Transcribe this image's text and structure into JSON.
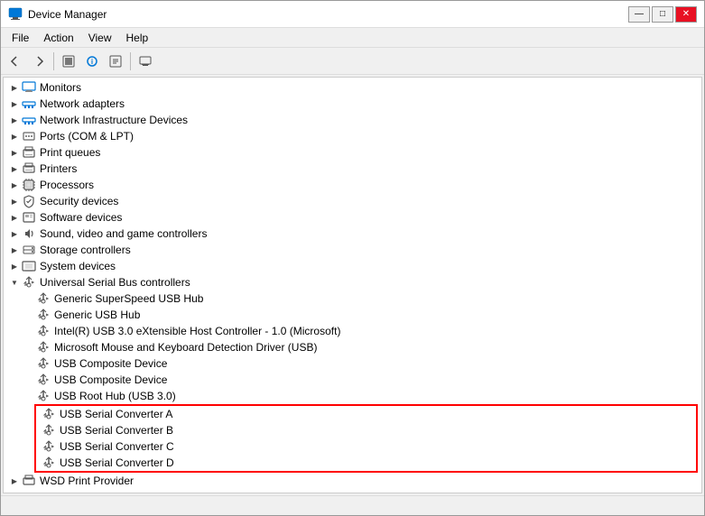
{
  "window": {
    "title": "Device Manager",
    "controls": {
      "minimize": "—",
      "maximize": "□",
      "close": "✕"
    }
  },
  "menu": {
    "items": [
      "File",
      "Action",
      "View",
      "Help"
    ]
  },
  "toolbar": {
    "buttons": [
      "←",
      "→",
      "⬜",
      "ℹ",
      "⬜",
      "🖥"
    ]
  },
  "tree": {
    "items": [
      {
        "id": "monitors",
        "label": "Monitors",
        "indent": 0,
        "chevron": "closed",
        "icon": "monitor"
      },
      {
        "id": "network-adapters",
        "label": "Network adapters",
        "indent": 0,
        "chevron": "closed",
        "icon": "network"
      },
      {
        "id": "network-infra",
        "label": "Network Infrastructure Devices",
        "indent": 0,
        "chevron": "closed",
        "icon": "network"
      },
      {
        "id": "ports",
        "label": "Ports (COM & LPT)",
        "indent": 0,
        "chevron": "closed",
        "icon": "generic"
      },
      {
        "id": "print-queues",
        "label": "Print queues",
        "indent": 0,
        "chevron": "closed",
        "icon": "printer"
      },
      {
        "id": "printers",
        "label": "Printers",
        "indent": 0,
        "chevron": "closed",
        "icon": "printer"
      },
      {
        "id": "processors",
        "label": "Processors",
        "indent": 0,
        "chevron": "closed",
        "icon": "chip"
      },
      {
        "id": "security",
        "label": "Security devices",
        "indent": 0,
        "chevron": "closed",
        "icon": "security"
      },
      {
        "id": "software",
        "label": "Software devices",
        "indent": 0,
        "chevron": "closed",
        "icon": "generic"
      },
      {
        "id": "sound",
        "label": "Sound, video and game controllers",
        "indent": 0,
        "chevron": "closed",
        "icon": "sound"
      },
      {
        "id": "storage",
        "label": "Storage controllers",
        "indent": 0,
        "chevron": "closed",
        "icon": "storage"
      },
      {
        "id": "system",
        "label": "System devices",
        "indent": 0,
        "chevron": "closed",
        "icon": "system"
      },
      {
        "id": "usb",
        "label": "Universal Serial Bus controllers",
        "indent": 0,
        "chevron": "open",
        "icon": "usb"
      },
      {
        "id": "superspeed-hub",
        "label": "Generic SuperSpeed USB Hub",
        "indent": 1,
        "chevron": "none",
        "icon": "usb-device"
      },
      {
        "id": "generic-hub",
        "label": "Generic USB Hub",
        "indent": 1,
        "chevron": "none",
        "icon": "usb-device"
      },
      {
        "id": "intel-usb",
        "label": "Intel(R) USB 3.0 eXtensible Host Controller - 1.0 (Microsoft)",
        "indent": 1,
        "chevron": "none",
        "icon": "usb-device"
      },
      {
        "id": "ms-mouse",
        "label": "Microsoft Mouse and Keyboard Detection Driver (USB)",
        "indent": 1,
        "chevron": "none",
        "icon": "usb-device"
      },
      {
        "id": "usb-composite-1",
        "label": "USB Composite Device",
        "indent": 1,
        "chevron": "none",
        "icon": "usb-device"
      },
      {
        "id": "usb-composite-2",
        "label": "USB Composite Device",
        "indent": 1,
        "chevron": "none",
        "icon": "usb-device"
      },
      {
        "id": "usb-root-hub",
        "label": "USB Root Hub (USB 3.0)",
        "indent": 1,
        "chevron": "none",
        "icon": "usb-device"
      },
      {
        "id": "usb-serial-a",
        "label": "USB Serial Converter A",
        "indent": 1,
        "chevron": "none",
        "icon": "usb-device",
        "highlighted": true
      },
      {
        "id": "usb-serial-b",
        "label": "USB Serial Converter B",
        "indent": 1,
        "chevron": "none",
        "icon": "usb-device",
        "highlighted": true
      },
      {
        "id": "usb-serial-c",
        "label": "USB Serial Converter C",
        "indent": 1,
        "chevron": "none",
        "icon": "usb-device",
        "highlighted": true
      },
      {
        "id": "usb-serial-d",
        "label": "USB Serial Converter D",
        "indent": 1,
        "chevron": "none",
        "icon": "usb-device",
        "highlighted": true
      },
      {
        "id": "wsd-print",
        "label": "WSD Print Provider",
        "indent": 0,
        "chevron": "closed",
        "icon": "generic"
      }
    ]
  }
}
